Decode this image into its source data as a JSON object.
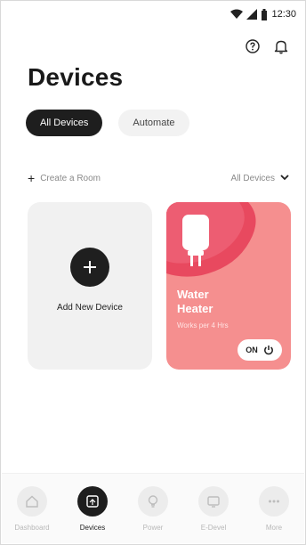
{
  "status_bar": {
    "time": "12:30"
  },
  "header": {
    "title": "Devices"
  },
  "tabs": [
    {
      "label": "All Devices",
      "active": true
    },
    {
      "label": "Automate",
      "active": false
    }
  ],
  "toolbar": {
    "create_room": "Create a Room",
    "filter": "All Devices"
  },
  "cards": {
    "add": {
      "label": "Add New Device"
    },
    "device": {
      "name_line1": "Water",
      "name_line2": "Heater",
      "subtitle": "Works per 4 Hrs",
      "state": "ON",
      "color": "#f58f8f"
    }
  },
  "bottom_nav": [
    {
      "label": "Dashboard",
      "icon": "home-icon",
      "active": false
    },
    {
      "label": "Devices",
      "icon": "devices-icon",
      "active": true
    },
    {
      "label": "Power",
      "icon": "bulb-icon",
      "active": false
    },
    {
      "label": "E-Devel",
      "icon": "display-icon",
      "active": false
    },
    {
      "label": "More",
      "icon": "more-icon",
      "active": false
    }
  ]
}
